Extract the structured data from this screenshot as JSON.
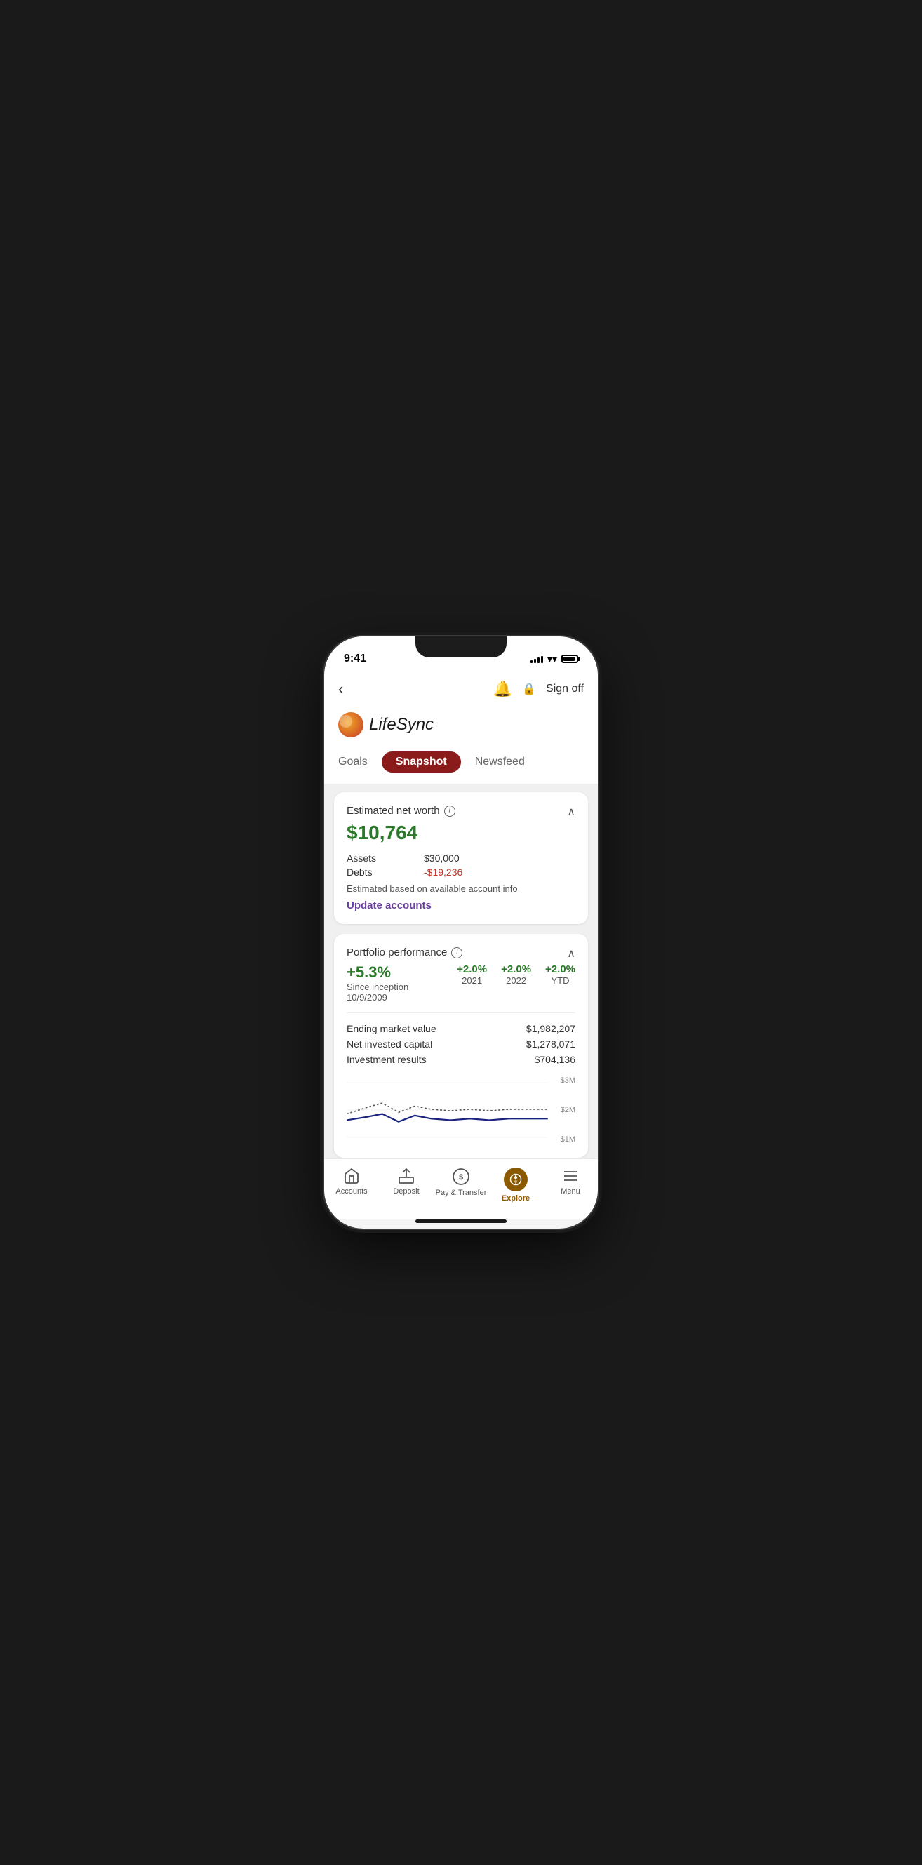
{
  "status": {
    "time": "9:41"
  },
  "header": {
    "back_label": "‹",
    "bell_label": "🔔",
    "lock_label": "🔒",
    "sign_off_label": "Sign off"
  },
  "logo": {
    "text": "LifeSync"
  },
  "tabs": [
    {
      "id": "goals",
      "label": "Goals",
      "active": false
    },
    {
      "id": "snapshot",
      "label": "Snapshot",
      "active": true
    },
    {
      "id": "newsfeed",
      "label": "Newsfeed",
      "active": false
    }
  ],
  "net_worth_card": {
    "title": "Estimated net worth",
    "value": "$10,764",
    "assets_label": "Assets",
    "assets_value": "$30,000",
    "debts_label": "Debts",
    "debts_value": "-$19,236",
    "note": "Estimated based on available account info",
    "update_label": "Update accounts"
  },
  "portfolio_card": {
    "title": "Portfolio performance",
    "main_perf": "+5.3%",
    "since_label": "Since inception",
    "since_date": "10/9/2009",
    "year_perfs": [
      {
        "value": "+2.0%",
        "label": "2021"
      },
      {
        "value": "+2.0%",
        "label": "2022"
      },
      {
        "value": "+2.0%",
        "label": "YTD"
      }
    ],
    "ending_market_label": "Ending market value",
    "ending_market_value": "$1,982,207",
    "net_invested_label": "Net invested capital",
    "net_invested_value": "$1,278,071",
    "investment_results_label": "Investment results",
    "investment_results_value": "$704,136",
    "chart_labels": [
      "$3M",
      "$2M",
      "$1M"
    ]
  },
  "bottom_nav": [
    {
      "id": "accounts",
      "label": "Accounts",
      "active": false,
      "icon": "🏠"
    },
    {
      "id": "deposit",
      "label": "Deposit",
      "active": false,
      "icon": "⬆"
    },
    {
      "id": "pay-transfer",
      "label": "Pay & Transfer",
      "active": false,
      "icon": "💲"
    },
    {
      "id": "explore",
      "label": "Explore",
      "active": true,
      "icon": "⊙"
    },
    {
      "id": "menu",
      "label": "Menu",
      "active": false,
      "icon": "☰"
    }
  ]
}
